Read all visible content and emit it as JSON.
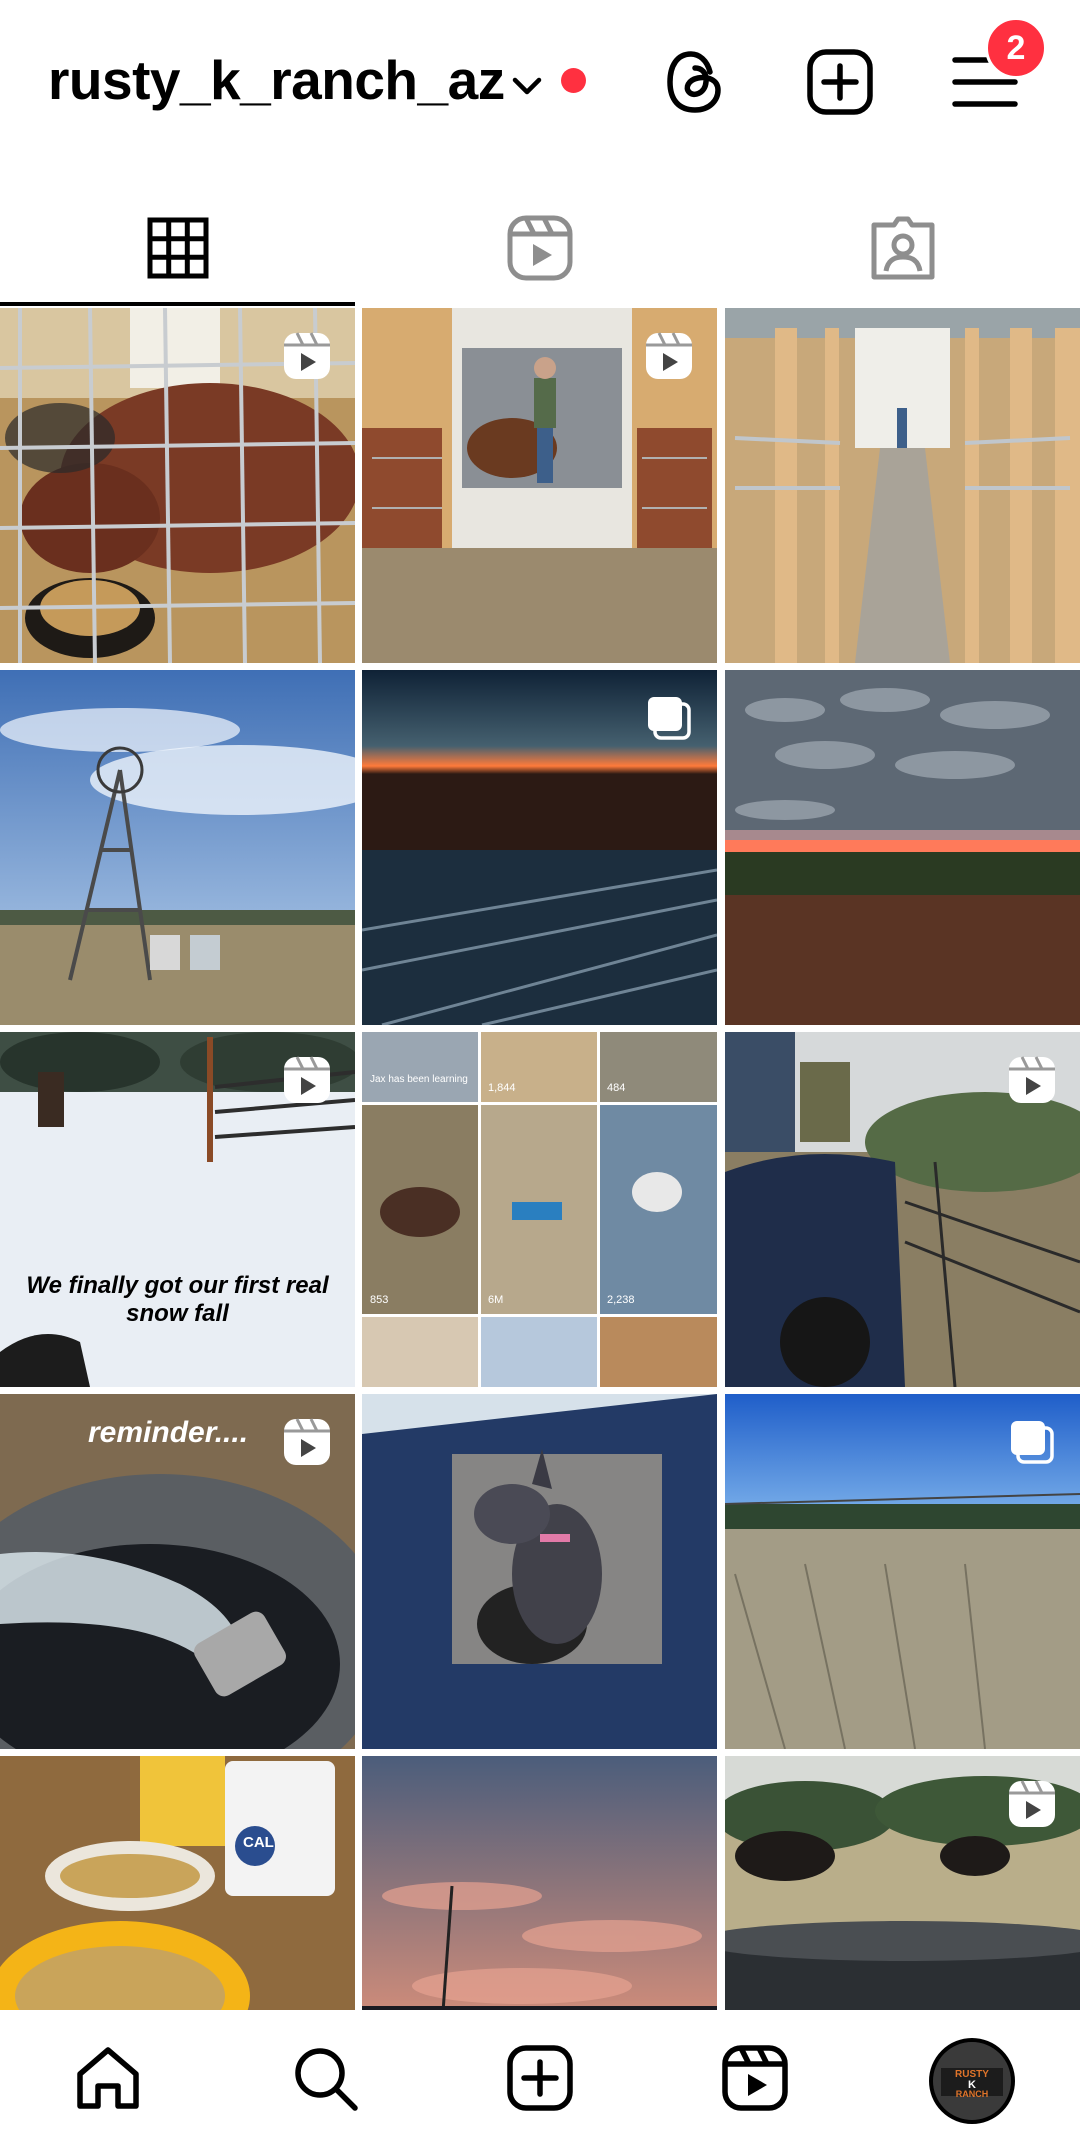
{
  "header": {
    "username": "rusty_k_ranch_az",
    "notification_count": "2",
    "icons": [
      "chevron-down-icon",
      "threads-icon",
      "create-post-icon",
      "menu-icon"
    ]
  },
  "tabs": [
    {
      "name": "posts-grid",
      "icon": "grid-icon",
      "selected": true
    },
    {
      "name": "reels",
      "icon": "reels-icon",
      "selected": false
    },
    {
      "name": "tagged",
      "icon": "tagged-icon",
      "selected": false
    }
  ],
  "grid": {
    "posts": [
      {
        "type": "reel",
        "subject": "pig eating from feeder"
      },
      {
        "type": "reel",
        "subject": "person in barn stall"
      },
      {
        "type": "photo",
        "subject": "barn aisle with stalls"
      },
      {
        "type": "photo",
        "subject": "windmill under sky"
      },
      {
        "type": "carousel",
        "subject": "sunset over metal roof"
      },
      {
        "type": "photo",
        "subject": "sunset clouds over field"
      },
      {
        "type": "reel",
        "subject": "snowy pasture",
        "caption": "We finally got our first real snow fall"
      },
      {
        "type": "photo",
        "subject": "profile collage",
        "collage_labels": [
          "Jax has been learning",
          "1,844",
          "484",
          "853",
          "6M",
          "2,238"
        ]
      },
      {
        "type": "reel",
        "subject": "truck by fence"
      },
      {
        "type": "reel",
        "subject": "water flowing into trough",
        "caption": "reminder...."
      },
      {
        "type": "photo",
        "subject": "dog in truck window"
      },
      {
        "type": "carousel",
        "subject": "frosty grass field"
      },
      {
        "type": "photo",
        "subject": "feed buckets",
        "bucket_label": "CAL"
      },
      {
        "type": "photo",
        "subject": "pink sunset sky"
      },
      {
        "type": "reel",
        "subject": "cattle near water tank"
      }
    ]
  },
  "bottom_nav": {
    "items": [
      "home-icon",
      "search-icon",
      "create-icon",
      "reels-icon",
      "profile-avatar"
    ],
    "avatar_text": "RUSTY K RANCH"
  },
  "colors": {
    "accent_red": "#ff3040",
    "text": "#000000",
    "background": "#ffffff"
  }
}
